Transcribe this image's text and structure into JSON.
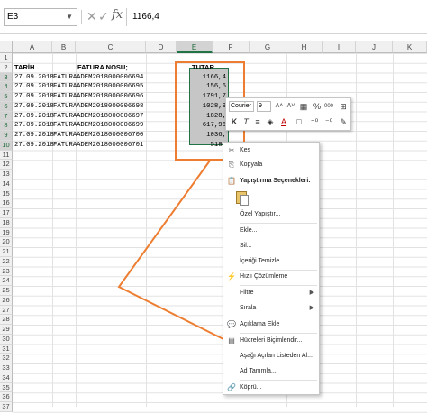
{
  "formula_bar": {
    "name_box": "E3",
    "cancel_glyph": "✕",
    "enter_glyph": "✓",
    "fx_label": "fx",
    "formula_value": "1166,4"
  },
  "columns": [
    "A",
    "B",
    "C",
    "D",
    "E",
    "F",
    "G",
    "H",
    "I",
    "J",
    "K"
  ],
  "rows": [
    "1",
    "2",
    "3",
    "4",
    "5",
    "6",
    "7",
    "8",
    "9",
    "10",
    "11",
    "12",
    "13",
    "14",
    "15",
    "16",
    "17",
    "18",
    "19",
    "20",
    "21",
    "22",
    "23",
    "24",
    "25",
    "26",
    "27",
    "28",
    "29",
    "30",
    "31",
    "32",
    "33",
    "34",
    "35",
    "36",
    "37"
  ],
  "headers": {
    "tarih": "TARİH",
    "fatura_nosu": "FATURA NOSU;",
    "tutar": "TUTAR"
  },
  "data_rows": [
    {
      "a": "27.09.2018",
      "b": "FATURA",
      "c": "ADEM2018000006694",
      "e": "1166,4"
    },
    {
      "a": "27.09.2018",
      "b": "FATURA",
      "c": "ADEM2018000006695",
      "e": "156,6"
    },
    {
      "a": "27.09.2018",
      "b": "FATURA",
      "c": "ADEM2018000006696",
      "e": "1791,7"
    },
    {
      "a": "27.09.2018",
      "b": "FATURA",
      "c": "ADEM2018000006698",
      "e": "1028,9"
    },
    {
      "a": "27.09.2018",
      "b": "FATURA",
      "c": "ADEM2018000006697",
      "e": "1828,"
    },
    {
      "a": "27.09.2018",
      "b": "FATURA",
      "c": "ADEM2018000006699",
      "e": "617,96"
    },
    {
      "a": "27.09.2018",
      "b": "FATURA",
      "c": "ADEM2018000006700",
      "e": "1036,"
    },
    {
      "a": "27.09.2018",
      "b": "FATURA",
      "c": "ADEM2018000006701",
      "e": "518,"
    }
  ],
  "mini_toolbar": {
    "font": "Courier N",
    "size": "9",
    "bold": "K",
    "italic": "T",
    "percent": "%",
    "thousands": "000",
    "align": "≡",
    "font_color_glyph": "A",
    "increase_font": "A˄",
    "decrease_font": "A˅"
  },
  "context_menu": {
    "cut": "Kes",
    "copy": "Kopyala",
    "paste_options": "Yapıştırma Seçenekleri:",
    "paste_special": "Özel Yapıştır...",
    "insert": "Ekle...",
    "delete": "Sil...",
    "clear_contents": "İçeriği Temizle",
    "quick_analysis": "Hızlı Çözümleme",
    "filter": "Filtre",
    "sort": "Sırala",
    "add_comment": "Açıklama Ekle",
    "format_cells": "Hücreleri Biçimlendir...",
    "pick_from_list": "Aşağı Açılan Listeden Al...",
    "define_name": "Ad Tanımla...",
    "hyperlink": "Köprü..."
  },
  "colors": {
    "accent": "#217346",
    "highlight": "#ed7d31",
    "selection": "#c6c6c6"
  }
}
